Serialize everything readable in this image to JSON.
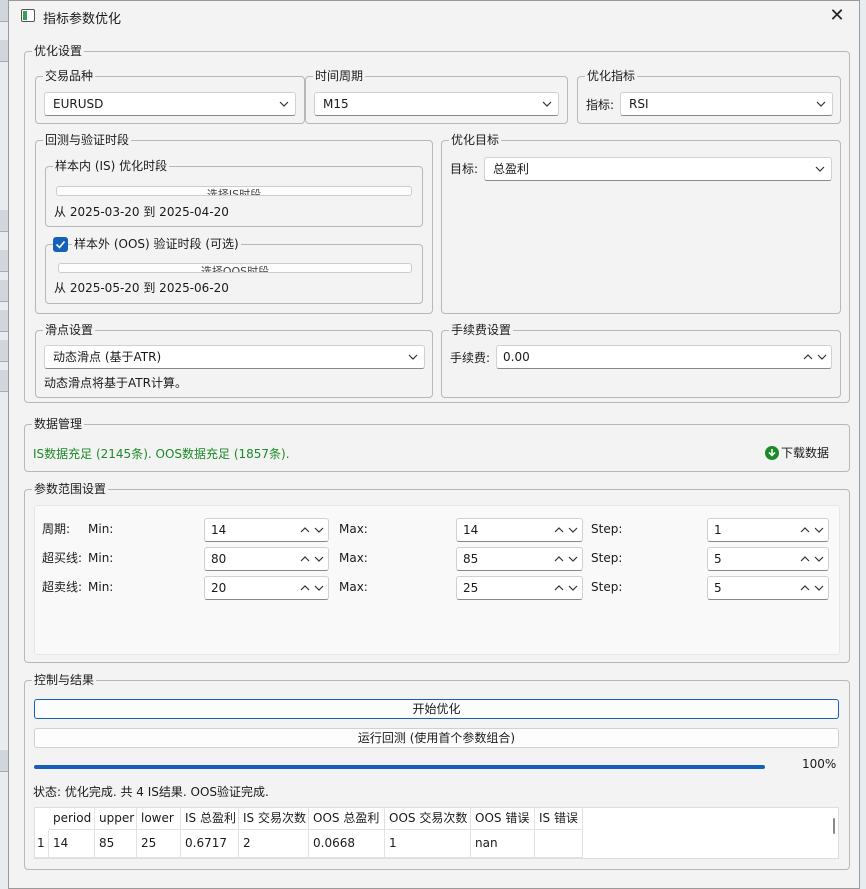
{
  "window": {
    "title": "指标参数优化"
  },
  "optimization_settings": {
    "group_label": "优化设置",
    "symbol": {
      "label": "交易品种",
      "value": "EURUSD"
    },
    "timeframe": {
      "label": "时间周期",
      "value": "M15"
    },
    "indicator": {
      "label": "优化指标",
      "field_label": "指标:",
      "value": "RSI"
    }
  },
  "periods": {
    "group_label": "回测与验证时段",
    "is": {
      "label": "样本内 (IS) 优化时段",
      "button": "选择IS时段",
      "range_text": "从 2025-03-20 到 2025-04-20"
    },
    "oos": {
      "label": "样本外 (OOS) 验证时段 (可选)",
      "checked": true,
      "button": "选择OOS时段",
      "range_text": "从 2025-05-20 到 2025-06-20"
    }
  },
  "target": {
    "group_label": "优化目标",
    "field_label": "目标:",
    "value": "总盈利"
  },
  "slippage": {
    "group_label": "滑点设置",
    "value": "动态滑点 (基于ATR)",
    "note": "动态滑点将基于ATR计算。"
  },
  "fee": {
    "group_label": "手续费设置",
    "field_label": "手续费:",
    "value": "0.00"
  },
  "data_mgmt": {
    "group_label": "数据管理",
    "status": "IS数据充足 (2145条). OOS数据充足 (1857条).",
    "download_label": "下载数据",
    "status_color": "#1c8a2a"
  },
  "param_range": {
    "group_label": "参数范围设置",
    "rows": [
      {
        "name": "周期:",
        "min_label": "Min:",
        "min": "14",
        "max_label": "Max:",
        "max": "14",
        "step_label": "Step:",
        "step": "1"
      },
      {
        "name": "超买线:",
        "min_label": "Min:",
        "min": "80",
        "max_label": "Max:",
        "max": "85",
        "step_label": "Step:",
        "step": "5"
      },
      {
        "name": "超卖线:",
        "min_label": "Min:",
        "min": "20",
        "max_label": "Max:",
        "max": "25",
        "step_label": "Step:",
        "step": "5"
      }
    ]
  },
  "control": {
    "group_label": "控制与结果",
    "start_button": "开始优化",
    "backtest_button": "运行回测 (使用首个参数组合)",
    "progress_value": 1.0,
    "progress_text": "100%",
    "status_text": "状态: 优化完成. 共 4 IS结果. OOS验证完成.",
    "accent_color": "#1561b9"
  },
  "results_table": {
    "columns": [
      "period",
      "upper",
      "lower",
      "IS 总盈利",
      "IS 交易次数",
      "OOS 总盈利",
      "OOS 交易次数",
      "OOS 错误",
      "IS 错误"
    ],
    "rows": [
      {
        "index": "1",
        "cells": [
          "14",
          "85",
          "25",
          "0.6717",
          "2",
          "0.0668",
          "1",
          "nan",
          ""
        ]
      }
    ]
  }
}
